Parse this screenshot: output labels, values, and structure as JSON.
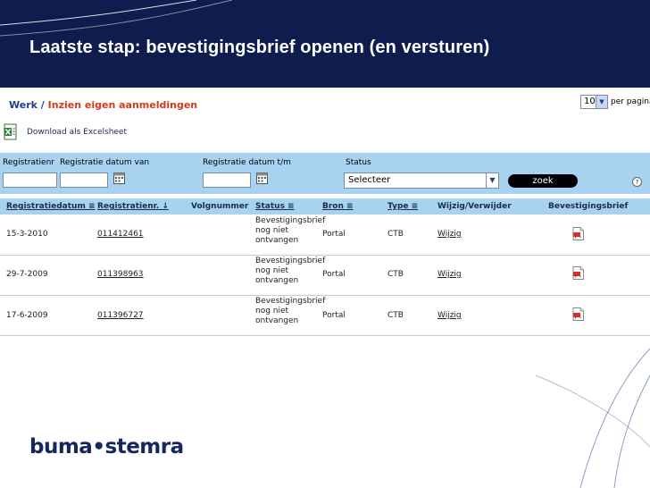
{
  "slide": {
    "title": "Laatste stap: bevestigingsbrief openen (en versturen)"
  },
  "breadcrumb": {
    "root": "Werk",
    "separator": "/",
    "current": "Inzien eigen aanmeldingen"
  },
  "pager": {
    "per_page_value": "10",
    "per_page_label": "per pagina"
  },
  "export": {
    "label": "Download als Excelsheet",
    "icon": "excel-icon"
  },
  "filters": {
    "registratienr_label": "Registratienr",
    "datum_van_label": "Registratie datum van",
    "datum_tm_label": "Registratie datum t/m",
    "status_label": "Status",
    "status_selected": "Selecteer",
    "zoek_label": "zoek",
    "help_label": "?"
  },
  "table": {
    "columns": [
      "Registratiedatum ≡",
      "Registratienr. ↓",
      "Volgnummer",
      "Status ≡",
      "Bron ≡",
      "Type ≡",
      "Wijzig/Verwijder",
      "Bevestigingsbrief"
    ],
    "rows": [
      {
        "datum": "15-3-2010",
        "nr": "011412461",
        "volgnummer": "",
        "status": [
          "Bevestigingsbrief",
          "nog niet",
          "ontvangen"
        ],
        "bron": "Portal",
        "type": "CTB",
        "actie": "Wijzig",
        "brief_icon": "pdf-icon"
      },
      {
        "datum": "29-7-2009",
        "nr": "011398963",
        "volgnummer": "",
        "status": [
          "Bevestigingsbrief",
          "nog niet",
          "ontvangen"
        ],
        "bron": "Portal",
        "type": "CTB",
        "actie": "Wijzig",
        "brief_icon": "pdf-icon"
      },
      {
        "datum": "17-6-2009",
        "nr": "011396727",
        "volgnummer": "",
        "status": [
          "Bevestigingsbrief",
          "nog niet",
          "ontvangen"
        ],
        "bron": "Portal",
        "type": "CTB",
        "actie": "Wijzig",
        "brief_icon": "pdf-icon"
      }
    ]
  },
  "logo": {
    "text": "buma•stemra"
  },
  "colors": {
    "header_bg": "#0f1c4e",
    "filter_bg": "#a8d3f0",
    "accent_red": "#d43a1a",
    "brand_navy": "#14285e"
  }
}
